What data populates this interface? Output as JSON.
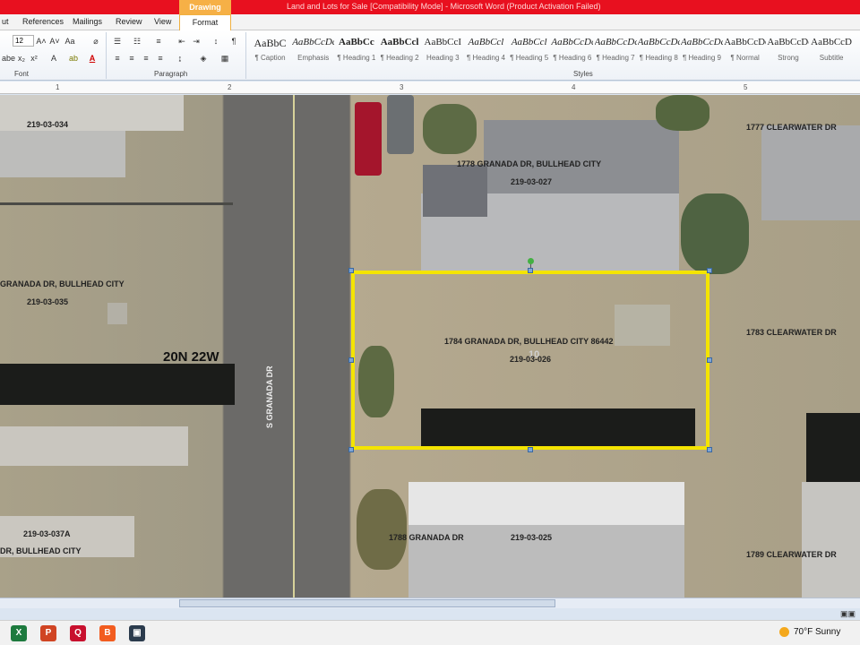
{
  "window": {
    "title": "Land and Lots for Sale [Compatibility Mode] - Microsoft Word (Product Activation Failed)",
    "contextual_tab_group": "Drawing Tools"
  },
  "tabs": {
    "layout_partial": "ut",
    "references": "References",
    "mailings": "Mailings",
    "review": "Review",
    "view": "View",
    "format": "Format"
  },
  "ribbon": {
    "font_size": "12",
    "font_group_label": "Font",
    "paragraph_group_label": "Paragraph",
    "styles_group_label": "Styles",
    "styles": [
      {
        "sample": "AaBbC",
        "name": "¶ Caption"
      },
      {
        "sample": "AaBbCcDc",
        "name": "Emphasis"
      },
      {
        "sample": "AaBbCc",
        "name": "¶ Heading 1"
      },
      {
        "sample": "AaBbCcl",
        "name": "¶ Heading 2"
      },
      {
        "sample": "AaBbCcI",
        "name": "Heading 3"
      },
      {
        "sample": "AaBbCcl",
        "name": "¶ Heading 4"
      },
      {
        "sample": "AaBbCcl",
        "name": "¶ Heading 5"
      },
      {
        "sample": "AaBbCcDc",
        "name": "¶ Heading 6"
      },
      {
        "sample": "AaBbCcDc",
        "name": "¶ Heading 7"
      },
      {
        "sample": "AaBbCcDc",
        "name": "¶ Heading 8"
      },
      {
        "sample": "AaBbCcDc",
        "name": "¶ Heading 9"
      },
      {
        "sample": "AaBbCcDd",
        "name": "¶ Normal"
      },
      {
        "sample": "AaBbCcDd",
        "name": "Strong"
      },
      {
        "sample": "AaBbCcD",
        "name": "Subtitle"
      }
    ]
  },
  "ruler": {
    "marks": [
      "1",
      "2",
      "3",
      "4",
      "5"
    ]
  },
  "map": {
    "parcels": [
      {
        "address": "1778 GRANADA DR, BULLHEAD CITY",
        "apn": "219-03-027"
      },
      {
        "address": "1784 GRANADA DR, BULLHEAD CITY 86442",
        "apn": "219-03-026",
        "lot_number": "10"
      },
      {
        "address": "1788 GRANADA DR",
        "apn": "219-03-025"
      },
      {
        "address": "GRANADA DR, BULLHEAD CITY",
        "apn": "219-03-035"
      },
      {
        "address": "DR, BULLHEAD CITY",
        "apn": "219-03-037A"
      },
      {
        "apn": "219-03-034"
      }
    ],
    "neighbors": {
      "clearwater_1777": "1777 CLEARWATER DR",
      "clearwater_1783": "1783 CLEARWATER DR",
      "clearwater_1789": "1789 CLEARWATER DR"
    },
    "township": "20N 22W",
    "street": "S GRANADA DR",
    "selection_color": "#f4e400"
  },
  "taskbar": {
    "apps": [
      {
        "icon": "excel-icon",
        "glyph": "X",
        "color": "#1d7a3e"
      },
      {
        "icon": "powerpoint-icon",
        "glyph": "P",
        "color": "#d04423"
      },
      {
        "icon": "quicken-icon",
        "glyph": "Q",
        "color": "#c8102e"
      },
      {
        "icon": "brave-icon",
        "glyph": "B",
        "color": "#f25c1f"
      },
      {
        "icon": "car-app-icon",
        "glyph": "▣",
        "color": "#2b3b4d"
      }
    ],
    "weather": "70°F  Sunny"
  }
}
